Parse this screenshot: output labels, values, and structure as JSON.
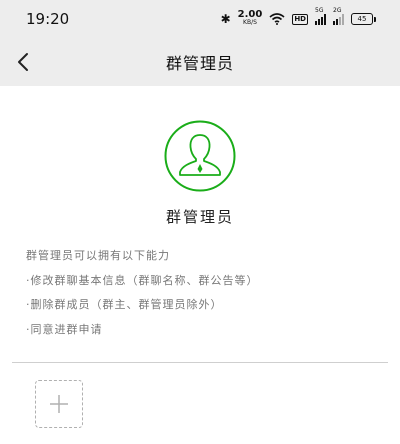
{
  "status_bar": {
    "time": "19:20",
    "bluetooth_icon": "bluetooth-icon",
    "net_speed_value": "2.00",
    "net_speed_unit": "KB/S",
    "hd_label": "HD",
    "sim1_label": "5G",
    "sim2_label": "2G",
    "battery": "45"
  },
  "nav": {
    "title": "群管理员",
    "back_icon": "chevron-left-icon"
  },
  "admin": {
    "role_label": "群管理员",
    "accent_color": "#1aad19"
  },
  "description": {
    "intro": "群管理员可以拥有以下能力",
    "items": [
      "·修改群聊基本信息（群聊名称、群公告等）",
      "·删除群成员（群主、群管理员除外）",
      "·同意进群申请"
    ]
  },
  "add_member": {
    "icon": "plus-icon"
  }
}
